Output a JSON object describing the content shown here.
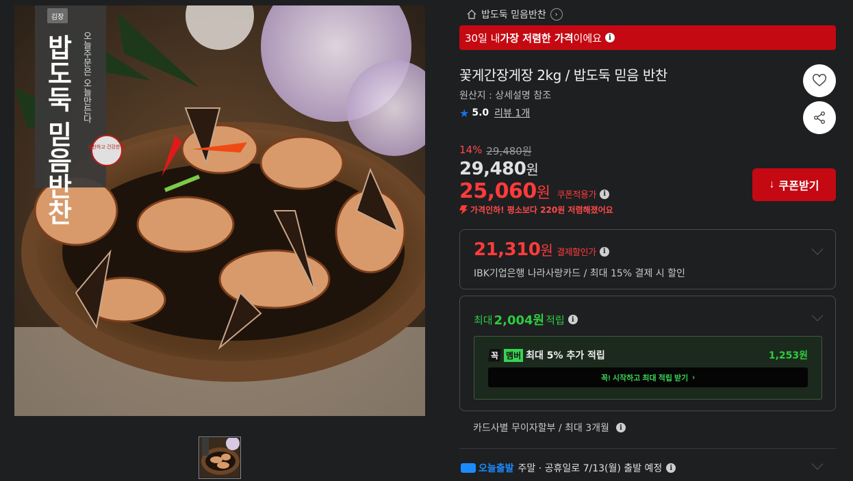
{
  "store": {
    "name": "밥도둑 믿음반찬",
    "chev": "›"
  },
  "banner": {
    "prefix": "30일 내 ",
    "strong": "가장 저렴한 가격",
    "suffix": "이에요"
  },
  "product": {
    "title": "꽃게간장게장 2kg / 밥도둑 믿음 반찬",
    "origin": "원산지 : 상세설명 참조",
    "rating": "5.0",
    "review_label": "리뷰 1개"
  },
  "pricing": {
    "discount_pct": "14%",
    "strike_price": "29,480원",
    "original_num": "29,480",
    "original_unit": "원",
    "coupon_num": "25,060",
    "coupon_unit": "원",
    "coupon_tag": "쿠폰적용가",
    "price_cut_note": "가격인하! 평소보다 220원 저렴해졌어요",
    "coupon_button": "쿠폰받기",
    "coupon_icon": "↓"
  },
  "card_discount": {
    "price_num": "21,310",
    "price_unit": "원",
    "label": "결제할인가",
    "desc": "IBK기업은행 나라사랑카드 / 최대 15% 결제 시 할인"
  },
  "points": {
    "prefix": "최대 ",
    "amount": "2,004원",
    "suffix": " 적립",
    "member_badge_k": "꼭",
    "member_badge_m": "멤버",
    "member_text": "최대 5% 추가 적립",
    "member_points": "1,253원",
    "start_button": "꼭! 시작하고 최대 적립 받기",
    "start_chev": "›"
  },
  "installment": "카드사별 무이자할부 / 최대 3개월",
  "shipping": {
    "brand": "오늘출발",
    "text": "주말 · 공휴일로 7/13(월) 출발 예정"
  },
  "image_label": {
    "brand": "김장",
    "line1": "밥도둑 믿음반찬",
    "side": "오늘주문은 오늘만든다",
    "stamp": "알찬하고 건강한 맛"
  },
  "colors": {
    "accent_red": "#c50912",
    "price_red": "#ff3b3b",
    "points_green": "#2ecc40",
    "star_blue": "#1a73e8"
  },
  "icons": {
    "wish": "heart-icon",
    "share": "share-icon",
    "info": "info-icon",
    "home": "home-icon"
  }
}
